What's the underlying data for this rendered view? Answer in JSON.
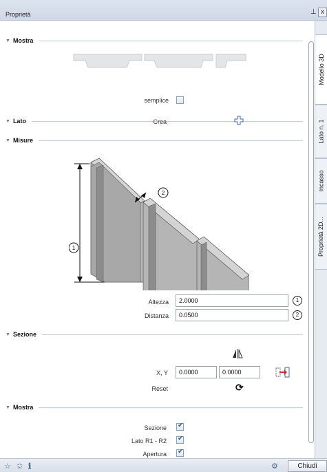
{
  "window": {
    "title": "Proprietà",
    "pin_icon": "pin-icon",
    "close_glyph": "x"
  },
  "sections": {
    "mostra_top": {
      "label": "Mostra",
      "option_label": "semplice"
    },
    "lato": {
      "label": "Lato",
      "create_label": "Crea",
      "create_icon": "add-side-icon"
    },
    "misure": {
      "label": "Misure",
      "fields": [
        {
          "label": "Altezza",
          "value": "2.0000",
          "marker": "1"
        },
        {
          "label": "Distanza",
          "value": "0.0500",
          "marker": "2"
        }
      ]
    },
    "sezione": {
      "label": "Sezione",
      "xy_label": "X, Y",
      "x_value": "0.0000",
      "y_value": "0.0000",
      "reset_label": "Reset"
    },
    "mostra_bottom": {
      "label": "Mostra",
      "options": [
        {
          "label": "Sezione",
          "checked": true
        },
        {
          "label": "Lato R1 - R2",
          "checked": true
        },
        {
          "label": "Apertura",
          "checked": true
        }
      ]
    }
  },
  "side_tabs": [
    "Modello 3D",
    "Lato n. 1",
    "Incasso",
    "Proprietà 2D..."
  ],
  "statusbar": {
    "close_button": "Chiudi"
  },
  "colors": {
    "accent_rule": "#b9cde6",
    "checkbox_check": "#2a5d9a",
    "arrow_red": "#d22"
  }
}
